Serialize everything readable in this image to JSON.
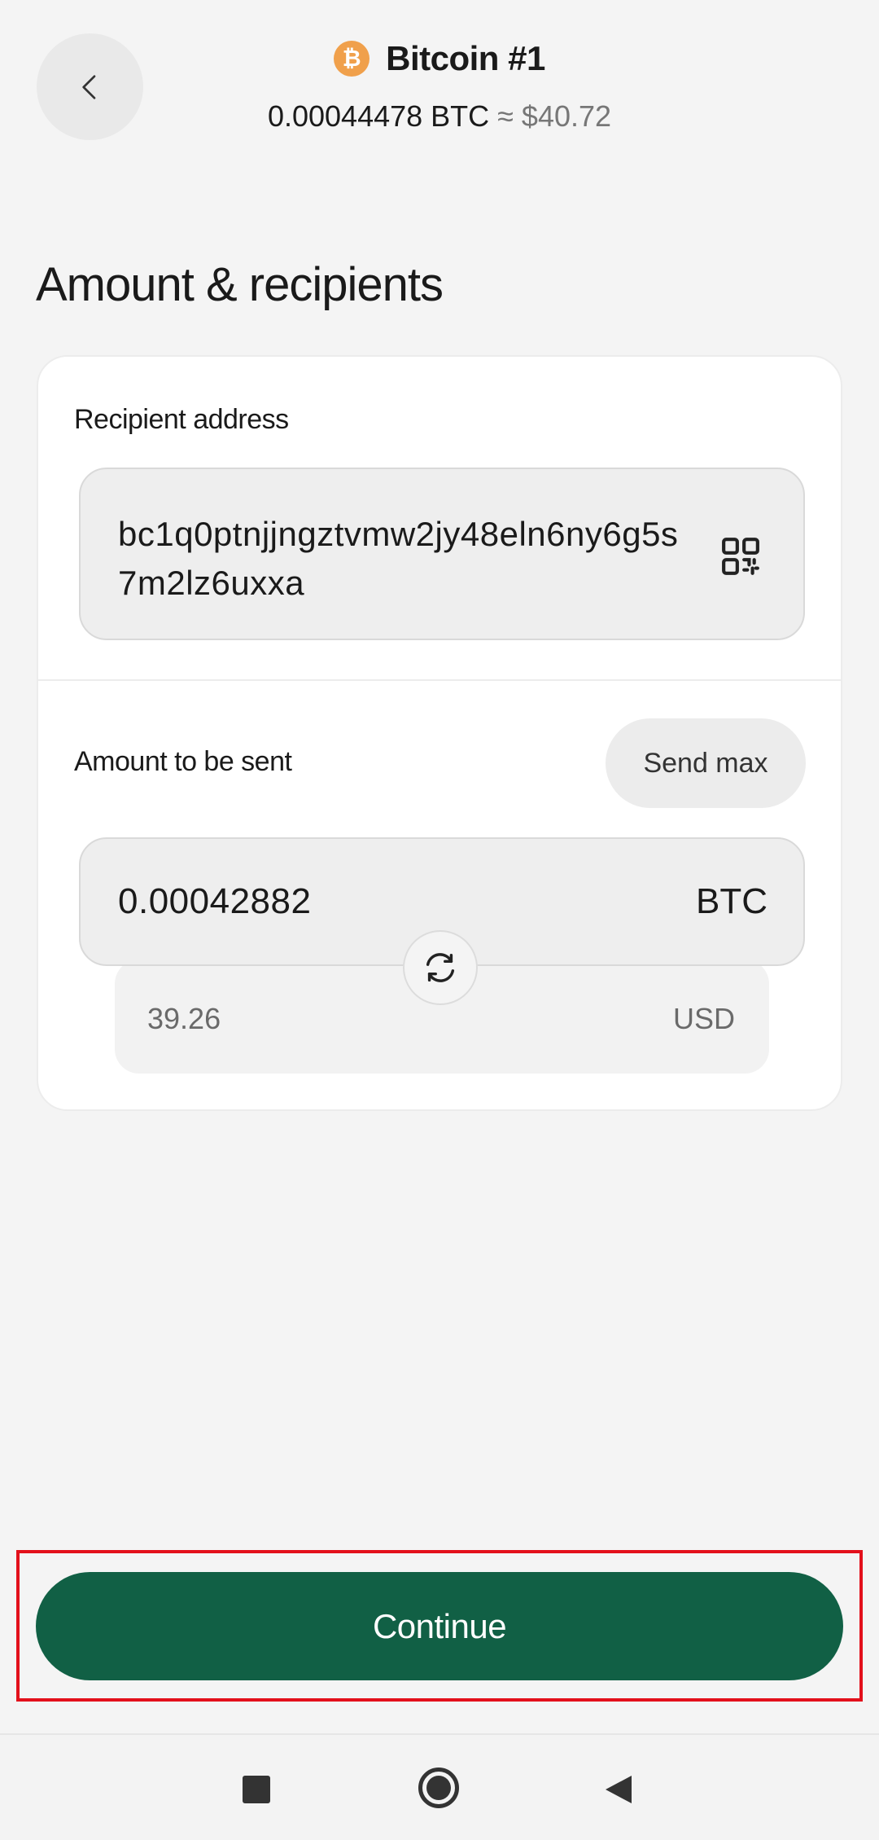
{
  "header": {
    "wallet_name": "Bitcoin #1",
    "coin_symbol_glyph": "₿",
    "balance_crypto": "0.00044478 BTC",
    "balance_approx": "≈ $40.72"
  },
  "section_title": "Amount & recipients",
  "recipient": {
    "label": "Recipient address",
    "address": "bc1q0ptnjjngztvmw2jy48eln6ny6g5s7m2lz6uxxa"
  },
  "amount": {
    "label": "Amount to be sent",
    "send_max_label": "Send max",
    "value": "0.00042882",
    "currency": "BTC",
    "fiat_value": "39.26",
    "fiat_currency": "USD"
  },
  "continue_label": "Continue",
  "colors": {
    "primary": "#116045",
    "coin": "#f0a04b",
    "highlight": "#e3101b"
  }
}
